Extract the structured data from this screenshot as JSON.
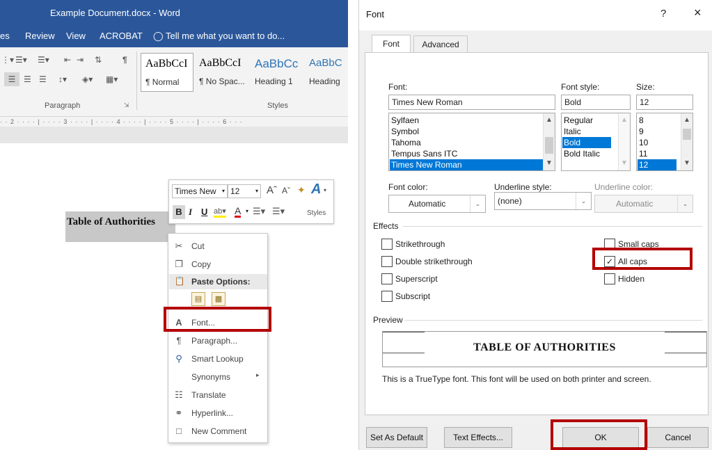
{
  "word": {
    "title": "Example Document.docx - Word",
    "menu": [
      "es",
      "Review",
      "View",
      "ACROBAT",
      "Tell me what you want to do..."
    ],
    "ribbon": {
      "paragraph_group": "Paragraph",
      "styles_group": "Styles",
      "styles": [
        {
          "preview": "AaBbCcI",
          "name": "¶ Normal"
        },
        {
          "preview": "AaBbCcI",
          "name": "¶ No Spac..."
        },
        {
          "preview": "AaBbCc",
          "name": "Heading 1"
        },
        {
          "preview": "AaBbC",
          "name": "Heading"
        }
      ]
    },
    "ruler_text": "· · 2 · · · · | · · · · 3 · · · · | · · · · 4 · · · · | · · · · 5 · · · · | · · · · 6 · · ·",
    "document_heading": "Table of Authorities",
    "mini_toolbar": {
      "font": "Times New",
      "size": "12",
      "styles_label": "Styles"
    },
    "context_menu": [
      {
        "label": "Cut",
        "icon": "scissors-icon"
      },
      {
        "label": "Copy",
        "icon": "copy-icon"
      },
      {
        "label": "Paste Options:",
        "icon": "clipboard-icon"
      },
      {
        "label": "Font...",
        "icon": "font-icon"
      },
      {
        "label": "Paragraph...",
        "icon": "paragraph-icon"
      },
      {
        "label": "Smart Lookup",
        "icon": "search-icon"
      },
      {
        "label": "Synonyms",
        "icon": ""
      },
      {
        "label": "Translate",
        "icon": "translate-icon"
      },
      {
        "label": "Hyperlink...",
        "icon": "globe-link-icon"
      },
      {
        "label": "New Comment",
        "icon": "comment-icon"
      }
    ]
  },
  "dialog": {
    "title": "Font",
    "help": "?",
    "close": "×",
    "tabs": [
      "Font",
      "Advanced"
    ],
    "font_label": "Font:",
    "font_value": "Times New Roman",
    "font_list": [
      "Sylfaen",
      "Symbol",
      "Tahoma",
      "Tempus Sans ITC",
      "Times New Roman"
    ],
    "style_label": "Font style:",
    "style_value": "Bold",
    "style_list": [
      "Regular",
      "Italic",
      "Bold",
      "Bold Italic"
    ],
    "size_label": "Size:",
    "size_value": "12",
    "size_list": [
      "8",
      "9",
      "10",
      "11",
      "12"
    ],
    "font_color_label": "Font color:",
    "font_color_value": "Automatic",
    "underline_style_label": "Underline style:",
    "underline_style_value": "(none)",
    "underline_color_label": "Underline color:",
    "underline_color_value": "Automatic",
    "effects_label": "Effects",
    "effects_left": [
      {
        "label": "Strikethrough",
        "checked": false
      },
      {
        "label": "Double strikethrough",
        "checked": false
      },
      {
        "label": "Superscript",
        "checked": false
      },
      {
        "label": "Subscript",
        "checked": false
      }
    ],
    "effects_right": [
      {
        "label": "Small caps",
        "checked": false
      },
      {
        "label": "All caps",
        "checked": true
      },
      {
        "label": "Hidden",
        "checked": false
      }
    ],
    "preview_label": "Preview",
    "preview_text": "TABLE OF AUTHORITIES",
    "truetype_note": "This is a TrueType font. This font will be used on both printer and screen.",
    "buttons": {
      "set_default": "Set As Default",
      "text_effects": "Text Effects...",
      "ok": "OK",
      "cancel": "Cancel"
    }
  },
  "colors": {
    "word_blue": "#2b579a",
    "highlight_red": "#b30000",
    "selection_blue": "#0078d7"
  }
}
